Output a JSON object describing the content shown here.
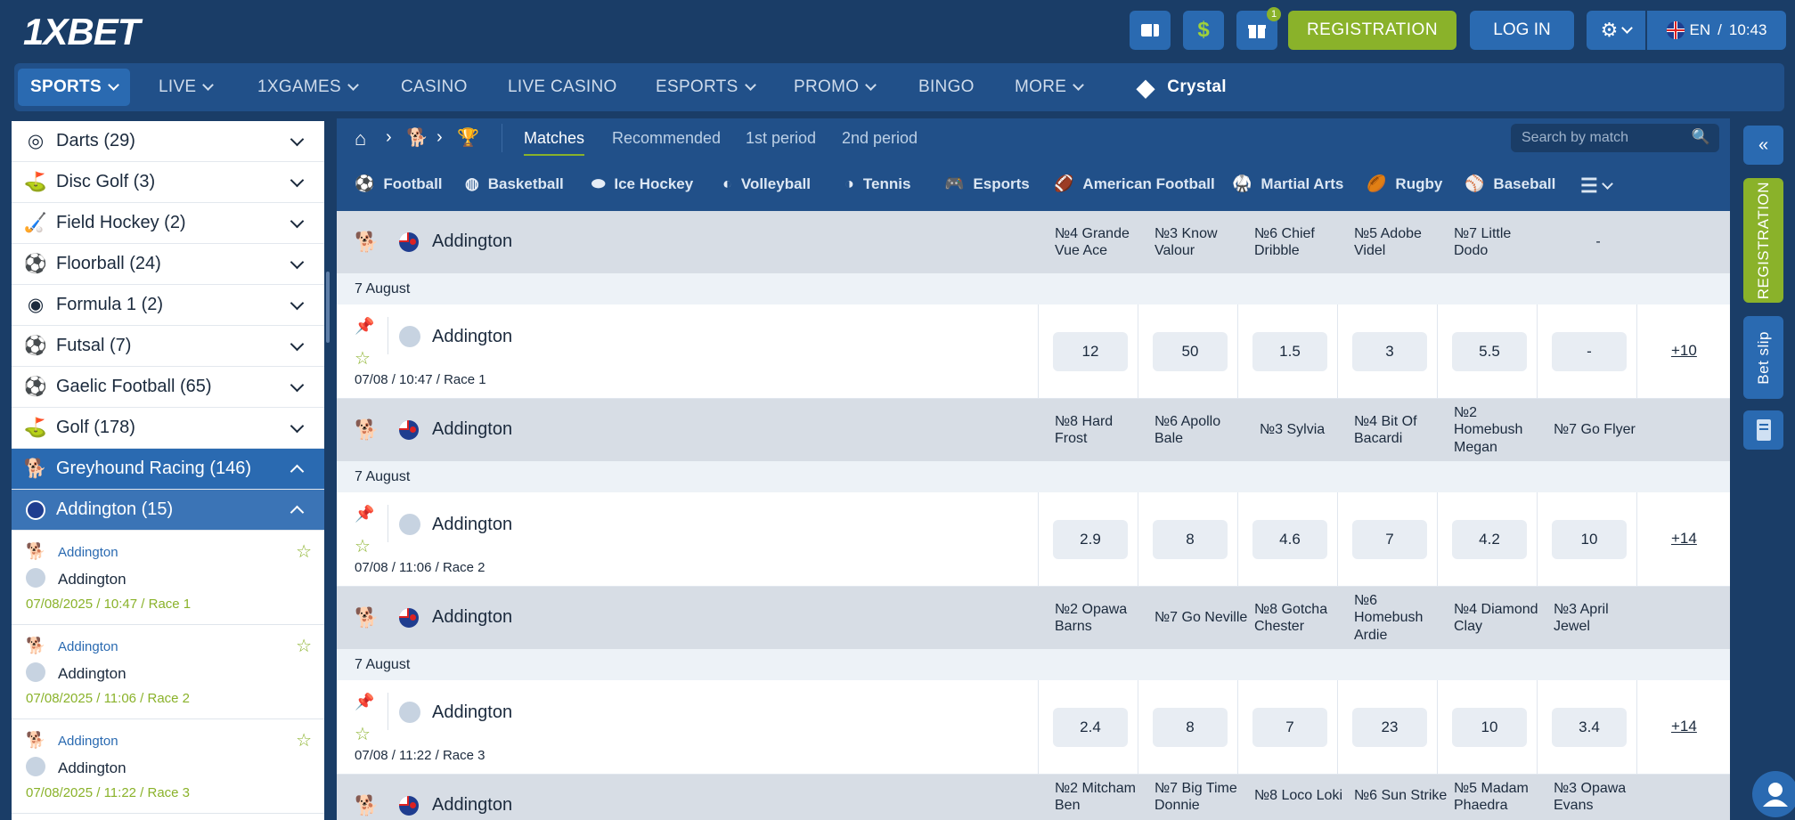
{
  "header": {
    "logo_one": "1X",
    "logo_bet": "BET",
    "registration": "REGISTRATION",
    "login": "LOG IN",
    "gift_badge": "1",
    "lang": "EN",
    "time": "10:43"
  },
  "nav": [
    {
      "label": "SPORTS",
      "active": true
    },
    {
      "label": "LIVE"
    },
    {
      "label": "1XGAMES"
    },
    {
      "label": "CASINO"
    },
    {
      "label": "LIVE CASINO"
    },
    {
      "label": "ESPORTS"
    },
    {
      "label": "PROMO"
    },
    {
      "label": "BINGO"
    },
    {
      "label": "MORE"
    },
    {
      "label": "Crystal"
    }
  ],
  "sidebar": {
    "sports": [
      {
        "label": "Darts (29)",
        "icon": "darts-icon"
      },
      {
        "label": "Disc Golf (3)",
        "icon": "disc-golf-icon"
      },
      {
        "label": "Field Hockey (2)",
        "icon": "field-hockey-icon"
      },
      {
        "label": "Floorball (24)",
        "icon": "floorball-icon"
      },
      {
        "label": "Formula 1 (2)",
        "icon": "formula-1-icon"
      },
      {
        "label": "Futsal (7)",
        "icon": "futsal-icon"
      },
      {
        "label": "Gaelic Football (65)",
        "icon": "gaelic-football-icon"
      },
      {
        "label": "Golf (178)",
        "icon": "golf-icon"
      },
      {
        "label": "Greyhound Racing (146)",
        "icon": "greyhound-icon"
      },
      {
        "label": "Addington (15)",
        "icon": "nz-flag-icon"
      }
    ],
    "events": [
      {
        "league": "Addington",
        "name": "Addington",
        "time": "07/08/2025 / 10:47 / Race 1"
      },
      {
        "league": "Addington",
        "name": "Addington",
        "time": "07/08/2025 / 11:06 / Race 2"
      },
      {
        "league": "Addington",
        "name": "Addington",
        "time": "07/08/2025 / 11:22 / Race 3"
      }
    ]
  },
  "main": {
    "tabs": [
      "Matches",
      "Recommended",
      "1st period",
      "2nd period"
    ],
    "search_placeholder": "Search by match",
    "sports": [
      "Football",
      "Basketball",
      "Ice Hockey",
      "Volleyball",
      "Tennis",
      "Esports",
      "American Football",
      "Martial Arts",
      "Rugby",
      "Baseball"
    ],
    "races": [
      {
        "league": "Addington",
        "runners": [
          "№4 Grande Vue Ace",
          "№3 Know Valour",
          "№6 Chief Dribble",
          "№5 Adobe Videl",
          "№7 Little Dodo",
          "-"
        ],
        "date": "7 August",
        "name": "Addington",
        "time": "07/08 / 10:47 / Race 1",
        "odds": [
          "12",
          "50",
          "1.5",
          "3",
          "5.5",
          "-"
        ],
        "more": "+10"
      },
      {
        "league": "Addington",
        "runners": [
          "№8 Hard Frost",
          "№6 Apollo Bale",
          "№3 Sylvia",
          "№4 Bit Of Bacardi",
          "№2 Homebush Megan",
          "№7 Go Flyer"
        ],
        "date": "7 August",
        "name": "Addington",
        "time": "07/08 / 11:06 / Race 2",
        "odds": [
          "2.9",
          "8",
          "4.6",
          "7",
          "4.2",
          "10"
        ],
        "more": "+14"
      },
      {
        "league": "Addington",
        "runners": [
          "№2 Opawa Barns",
          "№7 Go Neville",
          "№8 Gotcha Chester",
          "№6 Homebush Ardie",
          "№4 Diamond Clay",
          "№3 April Jewel"
        ],
        "date": "7 August",
        "name": "Addington",
        "time": "07/08 / 11:22 / Race 3",
        "odds": [
          "2.4",
          "8",
          "7",
          "23",
          "10",
          "3.4"
        ],
        "more": "+14"
      },
      {
        "league": "Addington",
        "runners": [
          "№2 Mitcham Ben",
          "№7 Big Time Donnie",
          "№8 Loco Loki",
          "№6 Sun Strike",
          "№5 Madam Phaedra",
          "№3 Opawa Evans"
        ]
      }
    ]
  },
  "rail": {
    "registration": "REGISTRATION",
    "bet_slip": "Bet slip"
  }
}
